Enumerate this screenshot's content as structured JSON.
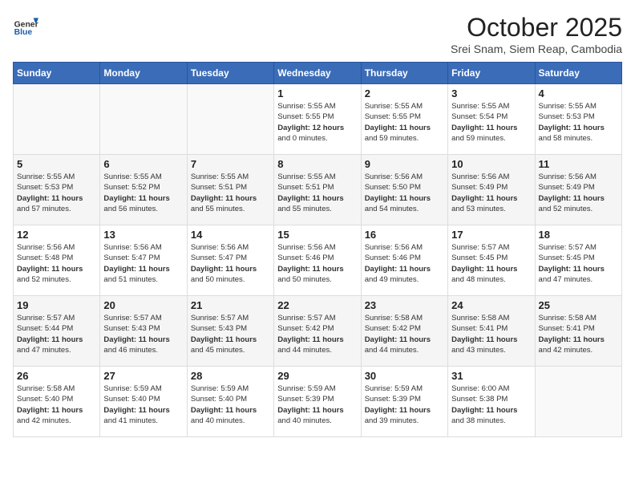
{
  "header": {
    "logo": {
      "line1": "General",
      "line2": "Blue"
    },
    "title": "October 2025",
    "subtitle": "Srei Snam, Siem Reap, Cambodia"
  },
  "weekdays": [
    "Sunday",
    "Monday",
    "Tuesday",
    "Wednesday",
    "Thursday",
    "Friday",
    "Saturday"
  ],
  "weeks": [
    [
      {
        "day": "",
        "info": ""
      },
      {
        "day": "",
        "info": ""
      },
      {
        "day": "",
        "info": ""
      },
      {
        "day": "1",
        "info": "Sunrise: 5:55 AM\nSunset: 5:55 PM\nDaylight: 12 hours\nand 0 minutes."
      },
      {
        "day": "2",
        "info": "Sunrise: 5:55 AM\nSunset: 5:55 PM\nDaylight: 11 hours\nand 59 minutes."
      },
      {
        "day": "3",
        "info": "Sunrise: 5:55 AM\nSunset: 5:54 PM\nDaylight: 11 hours\nand 59 minutes."
      },
      {
        "day": "4",
        "info": "Sunrise: 5:55 AM\nSunset: 5:53 PM\nDaylight: 11 hours\nand 58 minutes."
      }
    ],
    [
      {
        "day": "5",
        "info": "Sunrise: 5:55 AM\nSunset: 5:53 PM\nDaylight: 11 hours\nand 57 minutes."
      },
      {
        "day": "6",
        "info": "Sunrise: 5:55 AM\nSunset: 5:52 PM\nDaylight: 11 hours\nand 56 minutes."
      },
      {
        "day": "7",
        "info": "Sunrise: 5:55 AM\nSunset: 5:51 PM\nDaylight: 11 hours\nand 55 minutes."
      },
      {
        "day": "8",
        "info": "Sunrise: 5:55 AM\nSunset: 5:51 PM\nDaylight: 11 hours\nand 55 minutes."
      },
      {
        "day": "9",
        "info": "Sunrise: 5:56 AM\nSunset: 5:50 PM\nDaylight: 11 hours\nand 54 minutes."
      },
      {
        "day": "10",
        "info": "Sunrise: 5:56 AM\nSunset: 5:49 PM\nDaylight: 11 hours\nand 53 minutes."
      },
      {
        "day": "11",
        "info": "Sunrise: 5:56 AM\nSunset: 5:49 PM\nDaylight: 11 hours\nand 52 minutes."
      }
    ],
    [
      {
        "day": "12",
        "info": "Sunrise: 5:56 AM\nSunset: 5:48 PM\nDaylight: 11 hours\nand 52 minutes."
      },
      {
        "day": "13",
        "info": "Sunrise: 5:56 AM\nSunset: 5:47 PM\nDaylight: 11 hours\nand 51 minutes."
      },
      {
        "day": "14",
        "info": "Sunrise: 5:56 AM\nSunset: 5:47 PM\nDaylight: 11 hours\nand 50 minutes."
      },
      {
        "day": "15",
        "info": "Sunrise: 5:56 AM\nSunset: 5:46 PM\nDaylight: 11 hours\nand 50 minutes."
      },
      {
        "day": "16",
        "info": "Sunrise: 5:56 AM\nSunset: 5:46 PM\nDaylight: 11 hours\nand 49 minutes."
      },
      {
        "day": "17",
        "info": "Sunrise: 5:57 AM\nSunset: 5:45 PM\nDaylight: 11 hours\nand 48 minutes."
      },
      {
        "day": "18",
        "info": "Sunrise: 5:57 AM\nSunset: 5:45 PM\nDaylight: 11 hours\nand 47 minutes."
      }
    ],
    [
      {
        "day": "19",
        "info": "Sunrise: 5:57 AM\nSunset: 5:44 PM\nDaylight: 11 hours\nand 47 minutes."
      },
      {
        "day": "20",
        "info": "Sunrise: 5:57 AM\nSunset: 5:43 PM\nDaylight: 11 hours\nand 46 minutes."
      },
      {
        "day": "21",
        "info": "Sunrise: 5:57 AM\nSunset: 5:43 PM\nDaylight: 11 hours\nand 45 minutes."
      },
      {
        "day": "22",
        "info": "Sunrise: 5:57 AM\nSunset: 5:42 PM\nDaylight: 11 hours\nand 44 minutes."
      },
      {
        "day": "23",
        "info": "Sunrise: 5:58 AM\nSunset: 5:42 PM\nDaylight: 11 hours\nand 44 minutes."
      },
      {
        "day": "24",
        "info": "Sunrise: 5:58 AM\nSunset: 5:41 PM\nDaylight: 11 hours\nand 43 minutes."
      },
      {
        "day": "25",
        "info": "Sunrise: 5:58 AM\nSunset: 5:41 PM\nDaylight: 11 hours\nand 42 minutes."
      }
    ],
    [
      {
        "day": "26",
        "info": "Sunrise: 5:58 AM\nSunset: 5:40 PM\nDaylight: 11 hours\nand 42 minutes."
      },
      {
        "day": "27",
        "info": "Sunrise: 5:59 AM\nSunset: 5:40 PM\nDaylight: 11 hours\nand 41 minutes."
      },
      {
        "day": "28",
        "info": "Sunrise: 5:59 AM\nSunset: 5:40 PM\nDaylight: 11 hours\nand 40 minutes."
      },
      {
        "day": "29",
        "info": "Sunrise: 5:59 AM\nSunset: 5:39 PM\nDaylight: 11 hours\nand 40 minutes."
      },
      {
        "day": "30",
        "info": "Sunrise: 5:59 AM\nSunset: 5:39 PM\nDaylight: 11 hours\nand 39 minutes."
      },
      {
        "day": "31",
        "info": "Sunrise: 6:00 AM\nSunset: 5:38 PM\nDaylight: 11 hours\nand 38 minutes."
      },
      {
        "day": "",
        "info": ""
      }
    ]
  ]
}
